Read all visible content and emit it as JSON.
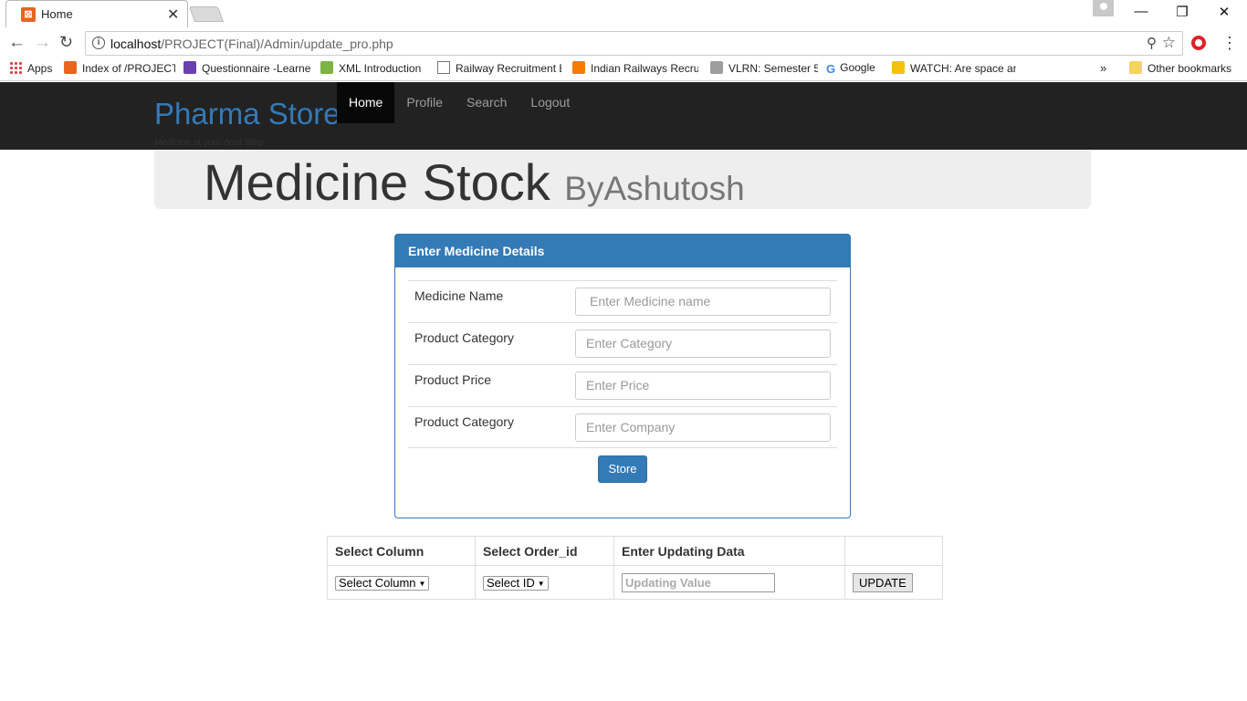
{
  "browser": {
    "tab_title": "Home",
    "url_host": "localhost",
    "url_path": "/PROJECT(Final)/Admin/update_pro.php",
    "bookmarks": [
      {
        "label": "Apps",
        "color": "#d44"
      },
      {
        "label": "Index of /PROJECT",
        "color": "#e8651f"
      },
      {
        "label": "Questionnaire -Learne",
        "color": "#6a3fb0"
      },
      {
        "label": "XML Introduction",
        "color": "#7cb342"
      },
      {
        "label": "Railway Recruitment E",
        "color": "#ffffff"
      },
      {
        "label": "Indian Railways Recru",
        "color": "#f57c00"
      },
      {
        "label": "VLRN: Semester 5",
        "color": "#9e9e9e"
      },
      {
        "label": "Google",
        "color": "#4285f4"
      },
      {
        "label": "WATCH: Are space an",
        "color": "#f4c20d"
      }
    ],
    "more_bookmarks": "»",
    "other_bookmarks": "Other bookmarks"
  },
  "navbar": {
    "brand": "Pharma Store",
    "tagline": "Medicine at your door Step",
    "items": [
      "Home",
      "Profile",
      "Search",
      "Logout"
    ]
  },
  "jumbotron": {
    "title": "Medicine Stock",
    "subtitle": "ByAshutosh"
  },
  "panel": {
    "heading": "Enter Medicine Details",
    "rows": [
      {
        "label": "Medicine Name",
        "placeholder": "Enter Medicine name"
      },
      {
        "label": "Product Category",
        "placeholder": "Enter Category"
      },
      {
        "label": "Product Price",
        "placeholder": "Enter Price"
      },
      {
        "label": "Product Category",
        "placeholder": "Enter Company"
      }
    ],
    "submit_label": "Store"
  },
  "update_table": {
    "headers": [
      "Select Column",
      "Select Order_id",
      "Enter Updating Data",
      ""
    ],
    "column_select": "Select Column",
    "id_select": "Select ID",
    "value_placeholder": "Updating Value",
    "button_label": "UPDATE"
  }
}
